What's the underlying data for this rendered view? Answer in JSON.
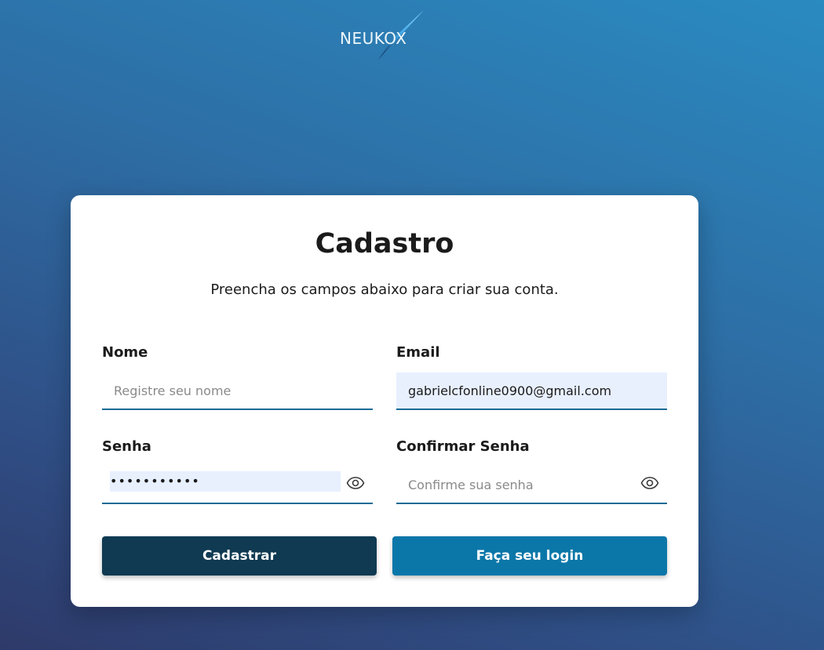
{
  "brand": {
    "name": "NEUKOX"
  },
  "form": {
    "title": "Cadastro",
    "subtitle": "Preencha os campos abaixo para criar sua conta.",
    "name": {
      "label": "Nome",
      "placeholder": "Registre seu nome",
      "value": ""
    },
    "email": {
      "label": "Email",
      "placeholder": "",
      "value": "gabrielcfonline0900@gmail.com"
    },
    "password": {
      "label": "Senha",
      "masked_value": "•••••••••••"
    },
    "confirm_password": {
      "label": "Confirmar Senha",
      "placeholder": "Confirme sua senha",
      "value": ""
    },
    "submit_label": "Cadastrar",
    "login_label": "Faça seu login"
  },
  "icons": {
    "password_toggle": "eye-icon",
    "confirm_toggle": "eye-icon"
  },
  "colors": {
    "primary_button": "#0f3a52",
    "secondary_button": "#0b77a9",
    "field_underline": "#1a6b96",
    "autofill_bg": "#e8f0fe"
  }
}
